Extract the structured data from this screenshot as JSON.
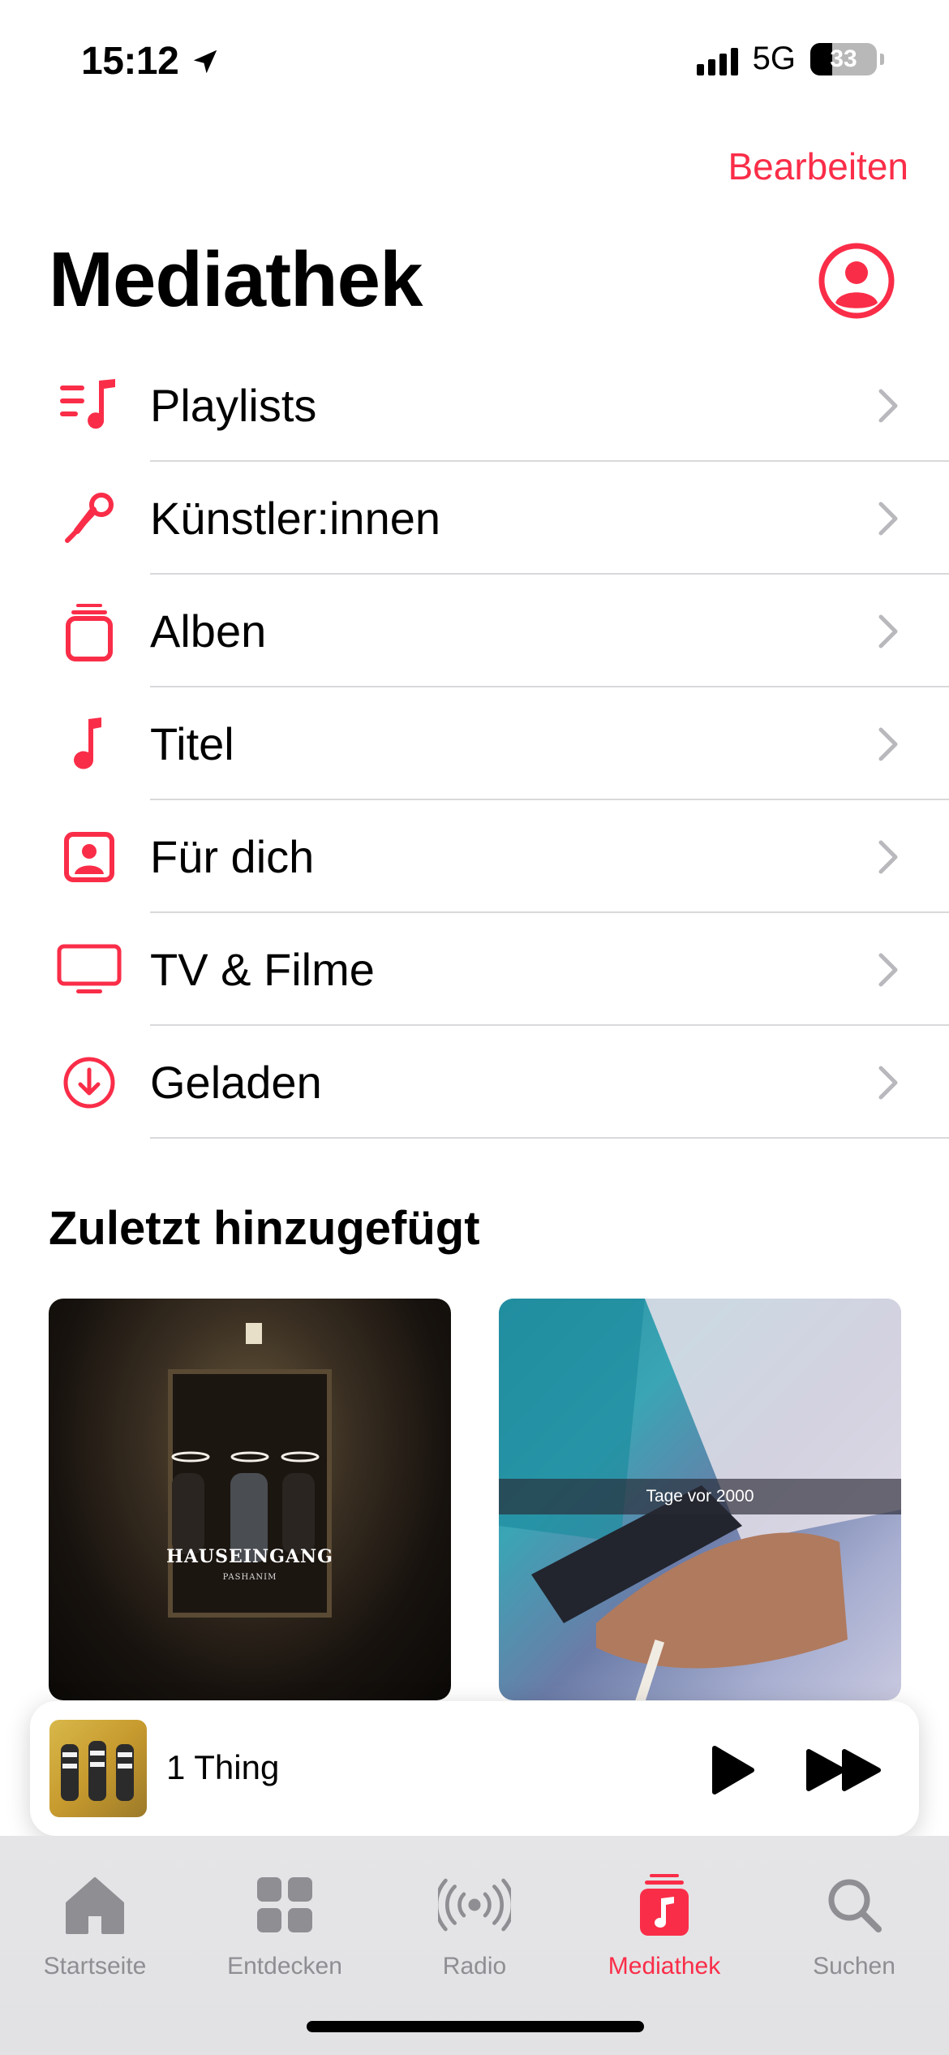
{
  "status_bar": {
    "time": "15:12",
    "network": "5G",
    "battery_level": "33",
    "battery_fraction": 0.33
  },
  "header": {
    "edit_label": "Bearbeiten",
    "title": "Mediathek"
  },
  "library_items": [
    {
      "label": "Playlists",
      "icon": "playlist-icon"
    },
    {
      "label": "Künstler:innen",
      "icon": "microphone-icon"
    },
    {
      "label": "Alben",
      "icon": "album-stack-icon"
    },
    {
      "label": "Titel",
      "icon": "music-note-icon"
    },
    {
      "label": "Für dich",
      "icon": "person-square-icon"
    },
    {
      "label": "TV & Filme",
      "icon": "tv-icon"
    },
    {
      "label": "Geladen",
      "icon": "download-circle-icon"
    }
  ],
  "recently_added": {
    "title": "Zuletzt hinzugefügt",
    "albums": [
      {
        "cover_title": "HAUSEINGANG",
        "cover_subtitle": "PASHANIM"
      },
      {
        "cover_title": "Tage vor 2000"
      }
    ]
  },
  "mini_player": {
    "track_title": "1 Thing"
  },
  "tabs": [
    {
      "label": "Startseite",
      "icon": "home-icon",
      "active": false
    },
    {
      "label": "Entdecken",
      "icon": "grid-icon",
      "active": false
    },
    {
      "label": "Radio",
      "icon": "radio-waves-icon",
      "active": false
    },
    {
      "label": "Mediathek",
      "icon": "library-icon",
      "active": true
    },
    {
      "label": "Suchen",
      "icon": "search-icon",
      "active": false
    }
  ],
  "colors": {
    "accent": "#fa2d48",
    "inactive_tab": "#8e8e93",
    "divider": "#d9d9dc"
  }
}
